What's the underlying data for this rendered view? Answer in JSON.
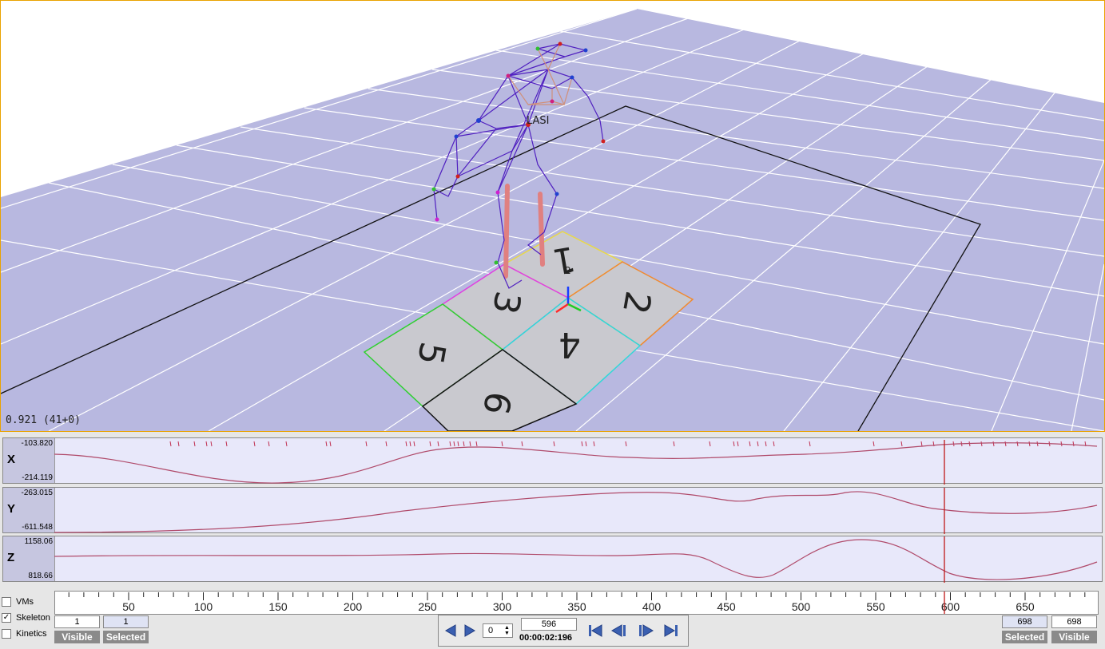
{
  "viewport": {
    "fps_readout": "0.921 (41+0)",
    "marker_label": "LASI",
    "marker_label_2": "2",
    "plates": [
      "1",
      "2",
      "3",
      "4",
      "5",
      "6"
    ]
  },
  "graphs": [
    {
      "axis": "X",
      "max": "-103.820",
      "min": "-214.119"
    },
    {
      "axis": "Y",
      "max": "-263.015",
      "min": "-611.548"
    },
    {
      "axis": "Z",
      "max": "1158.06",
      "min": "818.66"
    }
  ],
  "timeline": {
    "ticks": [
      "50",
      "100",
      "150",
      "200",
      "250",
      "300",
      "350",
      "400",
      "450",
      "500",
      "550",
      "600",
      "650"
    ],
    "current_frame_marker": 596
  },
  "checks": [
    {
      "label": "VMs",
      "checked": false
    },
    {
      "label": "Skeleton",
      "checked": true
    },
    {
      "label": "Kinetics",
      "checked": false
    }
  ],
  "range_left": {
    "visible_value": "1",
    "selected_value": "1",
    "visible_label": "Visible",
    "selected_label": "Selected"
  },
  "range_right": {
    "selected_value": "698",
    "visible_value": "698",
    "selected_label": "Selected",
    "visible_label": "Visible"
  },
  "transport": {
    "step_value": "0",
    "frame_value": "596",
    "timecode": "00:00:02:196"
  },
  "colors": {
    "floor": "#b8b8e0",
    "grid": "#ffffff",
    "curve": "#b04a6a",
    "cursor": "#c01818",
    "accent": "#e9a200"
  }
}
